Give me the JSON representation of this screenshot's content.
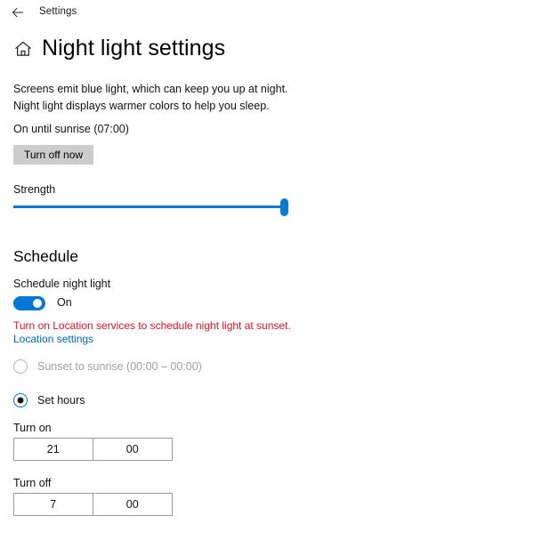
{
  "topbar": {
    "back_icon": "back-arrow-icon",
    "app_label": "Settings"
  },
  "header": {
    "home_icon": "home-icon",
    "title": "Night light settings"
  },
  "main": {
    "description": "Screens emit blue light, which can keep you up at night. Night light displays warmer colors to help you sleep.",
    "status": "On until sunrise (07:00)",
    "turn_off_button": "Turn off now",
    "strength": {
      "label": "Strength",
      "value_percent": 98
    }
  },
  "schedule": {
    "section_title": "Schedule",
    "toggle_label": "Schedule night light",
    "toggle_state": "On",
    "toggle_on": true,
    "warning_text": "Turn on Location services to schedule night light at sunset.",
    "location_link": "Location settings",
    "options": [
      {
        "label": "Sunset to sunrise (00:00 – 00:00)",
        "selected": false,
        "disabled": true
      },
      {
        "label": "Set hours",
        "selected": true,
        "disabled": false
      }
    ],
    "turn_on": {
      "label": "Turn on",
      "hour": "21",
      "minute": "00"
    },
    "turn_off": {
      "label": "Turn off",
      "hour": "7",
      "minute": "00"
    }
  },
  "colors": {
    "accent": "#0078d7",
    "link": "#0067c0",
    "warning": "#e81123",
    "button_bg": "#cccccc",
    "disabled_text": "#a0a0a0"
  }
}
